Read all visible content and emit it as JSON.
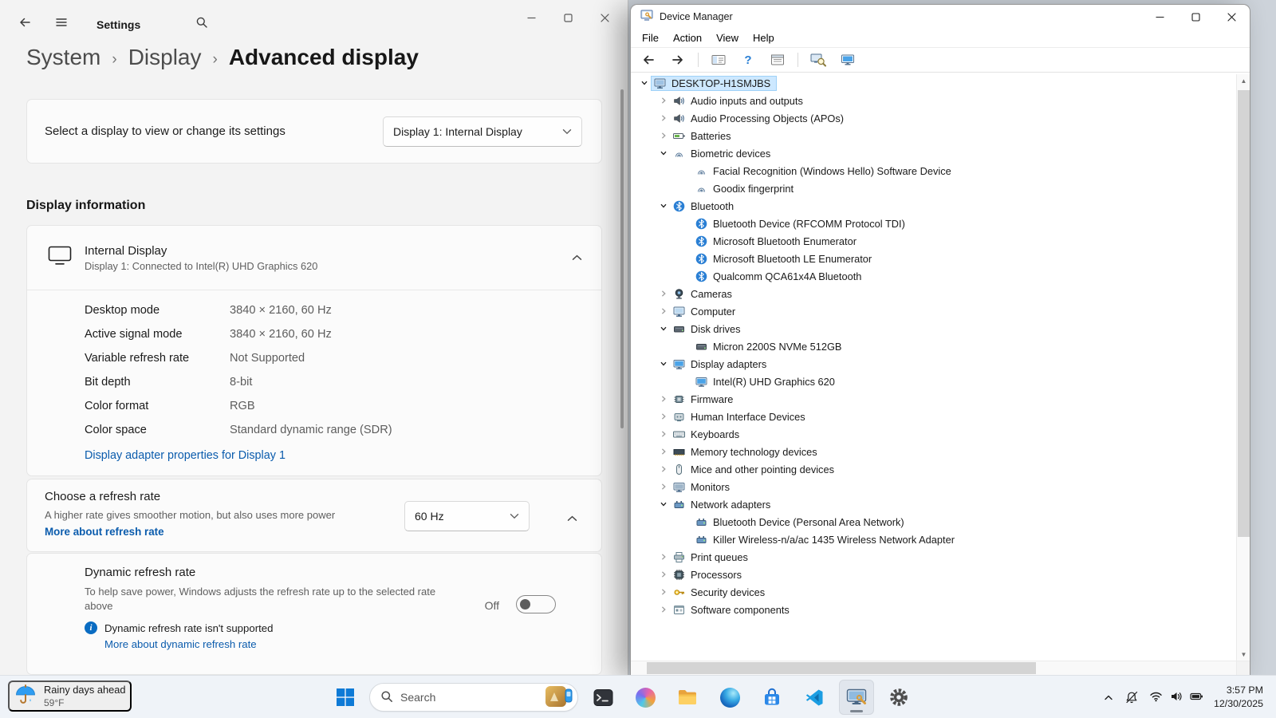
{
  "settings": {
    "titlebar": {
      "app_title": "Settings",
      "window_controls": [
        "minimize-icon",
        "maximize-icon",
        "close-icon"
      ]
    },
    "breadcrumb": [
      "System",
      "Display",
      "Advanced display"
    ],
    "selector": {
      "label": "Select a display to view or change its settings",
      "value": "Display 1: Internal Display"
    },
    "info_heading": "Display information",
    "display_card": {
      "title": "Internal Display",
      "subtitle": "Display 1: Connected to Intel(R) UHD Graphics 620",
      "rows": [
        {
          "label": "Desktop mode",
          "value": "3840 × 2160, 60 Hz"
        },
        {
          "label": "Active signal mode",
          "value": "3840 × 2160, 60 Hz"
        },
        {
          "label": "Variable refresh rate",
          "value": "Not Supported"
        },
        {
          "label": "Bit depth",
          "value": "8-bit"
        },
        {
          "label": "Color format",
          "value": "RGB"
        },
        {
          "label": "Color space",
          "value": "Standard dynamic range (SDR)"
        }
      ],
      "link": "Display adapter properties for Display 1"
    },
    "refresh_card": {
      "title": "Choose a refresh rate",
      "description": "A higher rate gives smoother motion, but also uses more power",
      "link": "More about refresh rate",
      "value": "60 Hz"
    },
    "dynamic_card": {
      "title": "Dynamic refresh rate",
      "description": "To help save power, Windows adjusts the refresh rate up to the selected rate above",
      "toggle_label": "Off",
      "notice": "Dynamic refresh rate isn't supported",
      "link": "More about dynamic refresh rate"
    }
  },
  "device_manager": {
    "title": "Device Manager",
    "menus": [
      "File",
      "Action",
      "View",
      "Help"
    ],
    "toolbar_icons": [
      "back-arrow-icon",
      "forward-arrow-icon",
      "console-tree-icon",
      "help-icon",
      "properties-list-icon",
      "scan-hardware-icon",
      "device-display-icon"
    ],
    "tree": [
      {
        "level": 0,
        "expand": "down",
        "icon": "computer",
        "label": "DESKTOP-H1SMJBS",
        "selected": true
      },
      {
        "level": 1,
        "expand": "right",
        "icon": "audio",
        "label": "Audio inputs and outputs"
      },
      {
        "level": 1,
        "expand": "right",
        "icon": "audio",
        "label": "Audio Processing Objects (APOs)"
      },
      {
        "level": 1,
        "expand": "right",
        "icon": "battery",
        "label": "Batteries"
      },
      {
        "level": 1,
        "expand": "down",
        "icon": "biometric",
        "label": "Biometric devices"
      },
      {
        "level": 2,
        "icon": "biometric",
        "label": "Facial Recognition (Windows Hello) Software Device"
      },
      {
        "level": 2,
        "icon": "biometric",
        "label": "Goodix fingerprint"
      },
      {
        "level": 1,
        "expand": "down",
        "icon": "bluetooth",
        "label": "Bluetooth"
      },
      {
        "level": 2,
        "icon": "bluetooth",
        "label": "Bluetooth Device (RFCOMM Protocol TDI)"
      },
      {
        "level": 2,
        "icon": "bluetooth",
        "label": "Microsoft Bluetooth Enumerator"
      },
      {
        "level": 2,
        "icon": "bluetooth",
        "label": "Microsoft Bluetooth LE Enumerator"
      },
      {
        "level": 2,
        "icon": "bluetooth",
        "label": "Qualcomm QCA61x4A Bluetooth"
      },
      {
        "level": 1,
        "expand": "right",
        "icon": "camera",
        "label": "Cameras"
      },
      {
        "level": 1,
        "expand": "right",
        "icon": "computer2",
        "label": "Computer"
      },
      {
        "level": 1,
        "expand": "down",
        "icon": "disk",
        "label": "Disk drives"
      },
      {
        "level": 2,
        "icon": "disk",
        "label": "Micron 2200S NVMe 512GB"
      },
      {
        "level": 1,
        "expand": "down",
        "icon": "display",
        "label": "Display adapters"
      },
      {
        "level": 2,
        "icon": "display",
        "label": "Intel(R) UHD Graphics 620"
      },
      {
        "level": 1,
        "expand": "right",
        "icon": "firmware",
        "label": "Firmware"
      },
      {
        "level": 1,
        "expand": "right",
        "icon": "hid",
        "label": "Human Interface Devices"
      },
      {
        "level": 1,
        "expand": "right",
        "icon": "keyboard",
        "label": "Keyboards"
      },
      {
        "level": 1,
        "expand": "right",
        "icon": "memory",
        "label": "Memory technology devices"
      },
      {
        "level": 1,
        "expand": "right",
        "icon": "mouse",
        "label": "Mice and other pointing devices"
      },
      {
        "level": 1,
        "expand": "right",
        "icon": "monitor",
        "label": "Monitors"
      },
      {
        "level": 1,
        "expand": "down",
        "icon": "network",
        "label": "Network adapters"
      },
      {
        "level": 2,
        "icon": "network",
        "label": "Bluetooth Device (Personal Area Network)"
      },
      {
        "level": 2,
        "icon": "network",
        "label": "Killer Wireless-n/a/ac 1435 Wireless Network Adapter"
      },
      {
        "level": 1,
        "expand": "right",
        "icon": "printer",
        "label": "Print queues"
      },
      {
        "level": 1,
        "expand": "right",
        "icon": "processor",
        "label": "Processors"
      },
      {
        "level": 1,
        "expand": "right",
        "icon": "security",
        "label": "Security devices"
      },
      {
        "level": 1,
        "expand": "right",
        "icon": "software",
        "label": "Software components"
      }
    ]
  },
  "taskbar": {
    "weather": {
      "headline": "Rainy days ahead",
      "temperature": "59°F"
    },
    "search_label": "Search",
    "apps": [
      "terminal",
      "copilot",
      "file-explorer",
      "edge",
      "microsoft-store",
      "dev-app",
      "device-manager",
      "settings"
    ],
    "active_app": "device-manager",
    "tray_icons": [
      "chevron-up-icon",
      "notifications-off-icon",
      "wifi-icon",
      "volume-icon",
      "battery-icon"
    ],
    "clock": {
      "time": "3:57 PM",
      "date": "12/30/2025"
    }
  },
  "colors": {
    "accent_link": "#0b5cad",
    "selection_bg": "#cde8ff",
    "taskbar_bg": "#eff3f8"
  }
}
